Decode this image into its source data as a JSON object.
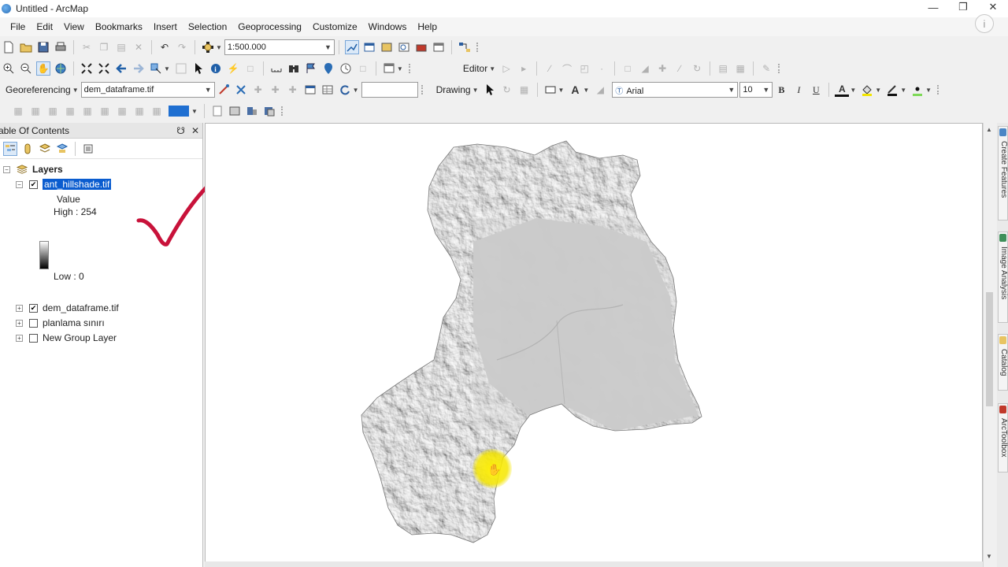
{
  "window": {
    "title": "Untitled - ArcMap"
  },
  "menu": [
    "File",
    "Edit",
    "View",
    "Bookmarks",
    "Insert",
    "Selection",
    "Geoprocessing",
    "Customize",
    "Windows",
    "Help"
  ],
  "toolbar": {
    "scale_value": "1:500.000",
    "editor_label": "Editor",
    "georeferencing_label": "Georeferencing",
    "georef_layer": "dem_dataframe.tif",
    "drawing_label": "Drawing",
    "font_name": "Arial",
    "font_size": "10",
    "bold": "B",
    "italic": "I",
    "underline": "U",
    "font_color_letter": "A"
  },
  "toc": {
    "title": "able Of Contents",
    "pin": "ਮ",
    "close": "✕",
    "root": "Layers",
    "layers": [
      {
        "name": "ant_hillshade.tif",
        "checked": true,
        "expanded": true,
        "selected": true
      },
      {
        "name": "dem_dataframe.tif",
        "checked": true,
        "expanded": false
      },
      {
        "name": "planlama sınırı",
        "checked": false,
        "expanded": false
      },
      {
        "name": "New Group Layer",
        "checked": false,
        "expanded": false
      }
    ],
    "legend": {
      "field": "Value",
      "high": "High : 254",
      "low": "Low : 0"
    }
  },
  "dock_tabs": [
    "Create Features",
    "Image Analysis",
    "Catalog",
    "ArcToolbox"
  ],
  "colors": {
    "selection": "#0a5ccf",
    "annotation": "#c8123a",
    "cursor_highlight": "#f2e500"
  }
}
